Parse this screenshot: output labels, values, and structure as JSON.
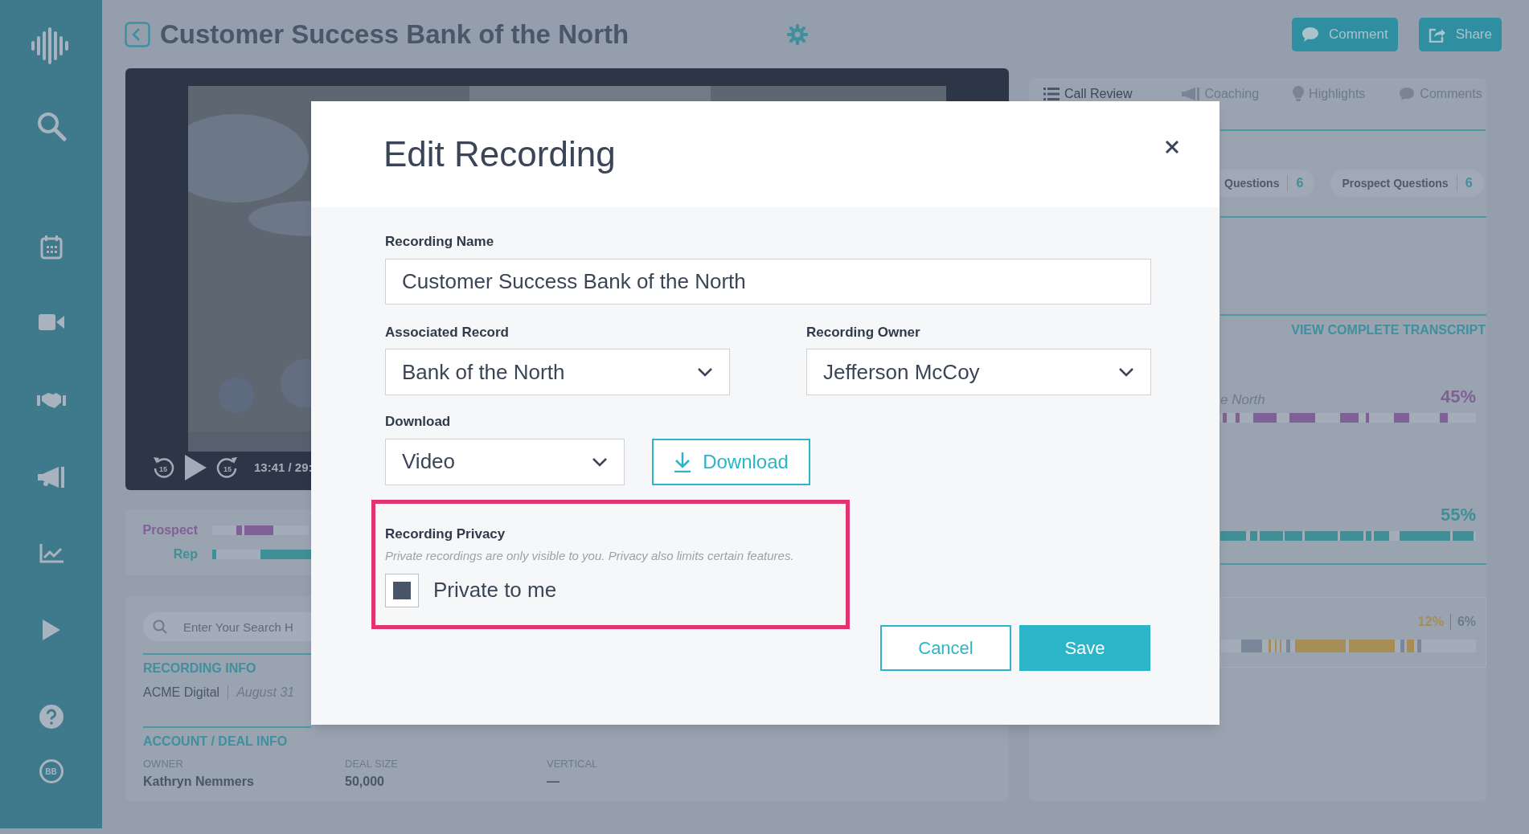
{
  "sidebar": {
    "avatar": "BB"
  },
  "header": {
    "title": "Customer Success Bank of the North",
    "buttons": [
      {
        "label": "Comment",
        "kind": "comment"
      },
      {
        "label": "Share",
        "kind": "share"
      }
    ]
  },
  "player": {
    "rewind_label": "15",
    "forward_label": "15",
    "time": "13:41 / 29:"
  },
  "speakers": [
    {
      "name": "Prospect",
      "color": "#7f6198"
    },
    {
      "name": "Rep",
      "color": "#3f8f96"
    }
  ],
  "search": {
    "placeholder": "Enter Your Search H"
  },
  "recording_info": {
    "heading": "RECORDING INFO",
    "company": "ACME Digital",
    "date": "August 31"
  },
  "deal_info": {
    "heading": "ACCOUNT / DEAL INFO",
    "fields": [
      {
        "label": "OWNER",
        "value": "Kathryn Nemmers"
      },
      {
        "label": "DEAL SIZE",
        "value": "50,000"
      },
      {
        "label": "VERTICAL",
        "value": "—"
      }
    ]
  },
  "review_panel": {
    "tabs": [
      {
        "label": "Call Review",
        "kind": "list",
        "selected": true
      },
      {
        "label": "Coaching",
        "kind": "megaphone",
        "selected": false
      },
      {
        "label": "Highlights",
        "kind": "bulb",
        "selected": false
      },
      {
        "label": "Comments",
        "kind": "bubble",
        "selected": false
      }
    ],
    "chips": [
      {
        "label": "Questions",
        "count": "6"
      },
      {
        "label": "Prospect Questions",
        "count": "6"
      }
    ],
    "transcript_link": "VIEW COMPLETE TRANSCRIPT",
    "talk_ratio": [
      {
        "label": "e North",
        "percent": "45%",
        "color": "#7f6198"
      },
      {
        "percent": "55%",
        "color": "#3f8f96"
      }
    ],
    "sentiment": {
      "positive": "12%",
      "negative": "6%"
    }
  },
  "modal": {
    "title": "Edit Recording",
    "name_label": "Recording Name",
    "name_value": "Customer Success Bank of the North",
    "record_label": "Associated Record",
    "record_value": "Bank of the North",
    "owner_label": "Recording Owner",
    "owner_value": "Jefferson McCoy",
    "download_label": "Download",
    "download_format": "Video",
    "download_button": "Download",
    "privacy": {
      "title": "Recording Privacy",
      "description": "Private recordings are only visible to you. Privacy also limits certain features.",
      "option": "Private to me",
      "checked": true,
      "highlighted": true
    },
    "buttons": [
      {
        "label": "Cancel",
        "kind": "secondary"
      },
      {
        "label": "Save",
        "kind": "primary"
      }
    ]
  }
}
